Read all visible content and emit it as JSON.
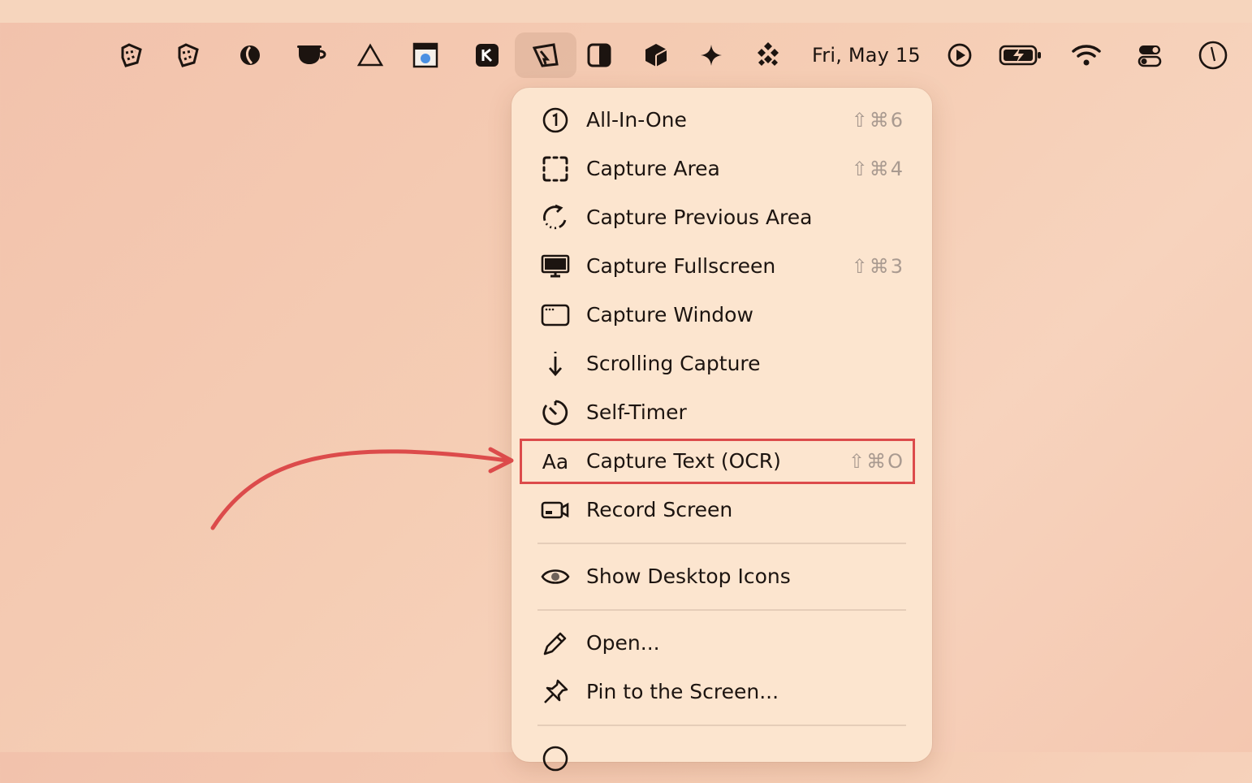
{
  "menubar": {
    "icons": [
      {
        "name": "retcon-icon"
      },
      {
        "name": "retcon-alt-icon"
      },
      {
        "name": "shell-icon"
      },
      {
        "name": "coffee-cup-icon"
      },
      {
        "name": "triangle-icon"
      },
      {
        "name": "browser-window-icon"
      },
      {
        "name": "k-app-icon"
      },
      {
        "name": "screenshot-app-icon"
      },
      {
        "name": "split-view-icon"
      },
      {
        "name": "box-icon"
      },
      {
        "name": "sparkle-icon"
      },
      {
        "name": "diamond-grid-icon"
      }
    ],
    "clock": "Fri, May 15",
    "status_icons": [
      {
        "name": "play-circle-icon"
      },
      {
        "name": "battery-charging-icon"
      },
      {
        "name": "wifi-icon"
      },
      {
        "name": "control-center-icon"
      },
      {
        "name": "clock-icon"
      }
    ]
  },
  "menu": {
    "items": [
      {
        "label": "All-In-One",
        "shortcut": "⇧⌘6",
        "icon": "circle-one-icon"
      },
      {
        "label": "Capture Area",
        "shortcut": "⇧⌘4",
        "icon": "dashed-frame-icon"
      },
      {
        "label": "Capture Previous Area",
        "shortcut": "",
        "icon": "circular-arrow-icon"
      },
      {
        "label": "Capture Fullscreen",
        "shortcut": "⇧⌘3",
        "icon": "monitor-icon"
      },
      {
        "label": "Capture Window",
        "shortcut": "",
        "icon": "window-icon"
      },
      {
        "label": "Scrolling Capture",
        "shortcut": "",
        "icon": "arrow-down-icon"
      },
      {
        "label": "Self-Timer",
        "shortcut": "",
        "icon": "timer-icon"
      },
      {
        "label": "Capture Text (OCR)",
        "shortcut": "⇧⌘O",
        "icon": "text-aa-icon",
        "icon_text": "Aa"
      },
      {
        "label": "Record Screen",
        "shortcut": "",
        "icon": "video-camera-icon"
      },
      {
        "label": "Show Desktop Icons",
        "shortcut": "",
        "icon": "eye-icon"
      },
      {
        "label": "Open...",
        "shortcut": "",
        "icon": "pencil-icon"
      },
      {
        "label": "Pin to the Screen...",
        "shortcut": "",
        "icon": "pin-icon"
      }
    ]
  },
  "annotation": {
    "highlight_color": "#dc4b4b"
  }
}
